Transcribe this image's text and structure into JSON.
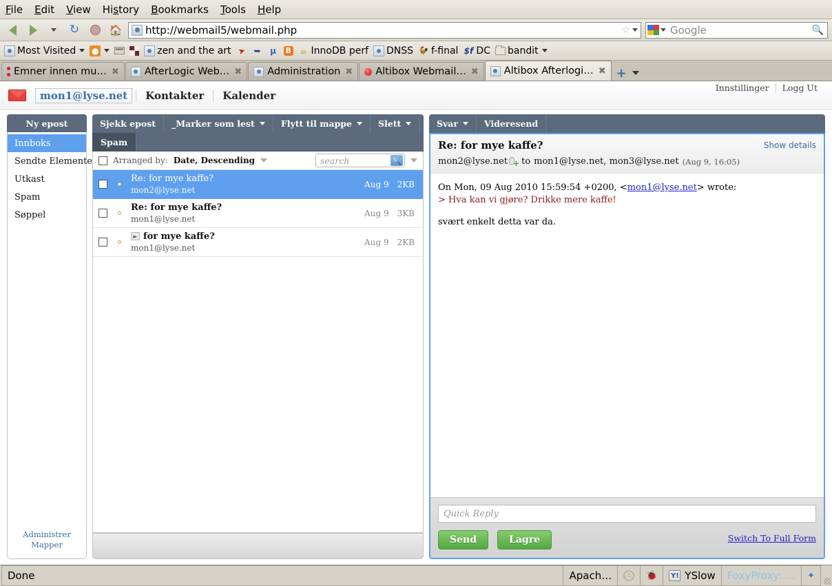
{
  "browser": {
    "menus": [
      "File",
      "Edit",
      "View",
      "History",
      "Bookmarks",
      "Tools",
      "Help"
    ],
    "url": "http://webmail5/webmail.php",
    "search_placeholder": "Google",
    "bookmarks": [
      {
        "label": "Most Visited",
        "icon": "site-icon",
        "caret": true
      },
      {
        "label": "",
        "icon": "rss-icon",
        "caret": true
      },
      {
        "label": "",
        "icon": "toolbar-icon",
        "caret": false
      },
      {
        "label": "",
        "icon": "squares-icon",
        "caret": false
      },
      {
        "label": "zen and the art",
        "icon": "site-icon",
        "caret": false
      },
      {
        "label": "",
        "icon": "red-arrow-icon",
        "caret": false
      },
      {
        "label": "",
        "icon": "blue-glyph-icon",
        "caret": false
      },
      {
        "label": "",
        "icon": "mu-icon",
        "caret": false
      },
      {
        "label": "",
        "icon": "blogger-icon",
        "caret": false
      },
      {
        "label": "InnoDB perf",
        "icon": "java-icon",
        "caret": false
      },
      {
        "label": "DNSS",
        "icon": "site-icon",
        "caret": false
      },
      {
        "label": "f-final",
        "icon": "duck-icon",
        "caret": false
      },
      {
        "label": "DC",
        "icon": "dc-icon",
        "caret": false
      },
      {
        "label": "bandit",
        "icon": "folder-icon",
        "caret": true
      }
    ],
    "tabs": [
      {
        "label": "Emner innen mu…",
        "icon": "dots-icon",
        "active": false
      },
      {
        "label": "AfterLogic Web…",
        "icon": "site-icon",
        "active": false
      },
      {
        "label": "Administration",
        "icon": "site-icon",
        "active": false
      },
      {
        "label": "Altibox Webmail…",
        "icon": "red-dot-icon",
        "active": false
      },
      {
        "label": "Altibox Afterlogi…",
        "icon": "site-icon",
        "active": true
      }
    ],
    "new_tab_label": "+"
  },
  "webmail": {
    "account": "mon1@lyse.net",
    "nav": [
      "Kontakter",
      "Kalender"
    ],
    "settings_label": "Innstillinger",
    "logout_label": "Logg Ut",
    "sidebar": {
      "compose_label": "Ny epost",
      "folders": [
        {
          "label": "Innboks",
          "selected": true
        },
        {
          "label": "Sendte Elementer",
          "selected": false
        },
        {
          "label": "Utkast",
          "selected": false
        },
        {
          "label": "Spam",
          "selected": false
        },
        {
          "label": "Søppel",
          "selected": false
        }
      ],
      "manage_folders_label": "Administrer Mapper"
    },
    "toolbar": [
      {
        "label": "Sjekk epost",
        "caret": false
      },
      {
        "label": "_Marker som lest",
        "caret": true
      },
      {
        "label": "Flytt til mappe",
        "caret": true
      },
      {
        "label": "Slett",
        "caret": true
      }
    ],
    "tabs2": [
      {
        "label": "Spam",
        "active": true
      }
    ],
    "list_header": {
      "arranged_by_label": "Arranged by:",
      "arranged_by_value": "Date, Descending",
      "search_placeholder": "search"
    },
    "messages": [
      {
        "subject": "Re: for mye kaffe?",
        "from": "mon2@lyse.net",
        "date": "Aug 9",
        "size": "2KB",
        "selected": true,
        "unread": false,
        "replied": false
      },
      {
        "subject": "Re: for mye kaffe?",
        "from": "mon1@lyse.net",
        "date": "Aug 9",
        "size": "3KB",
        "selected": false,
        "unread": true,
        "replied": false
      },
      {
        "subject": "for mye kaffe?",
        "from": "mon1@lyse.net",
        "date": "Aug 9",
        "size": "2KB",
        "selected": false,
        "unread": true,
        "replied": true
      }
    ],
    "read_toolbar": [
      {
        "label": "Svar",
        "caret": true
      },
      {
        "label": "Videresend",
        "caret": false
      }
    ],
    "message": {
      "subject": "Re: for mye kaffe?",
      "show_details_label": "Show details",
      "from": "mon2@lyse.net",
      "to_label": "to",
      "recipients": "mon1@lyse.net, mon3@lyse.net",
      "timestamp": "(Aug 9, 16:05)",
      "body_line1_pre": "On Mon, 09 Aug 2010 15:59:54 +0200, <",
      "body_line1_link": "mon1@lyse.net",
      "body_line1_post": "> wrote:",
      "body_quote": "> Hva kan vi gjøre? Drikke mere kaffe!",
      "body_line2": "svært enkelt detta var da."
    },
    "quick_reply": {
      "placeholder": "Quick Reply",
      "send_label": "Send",
      "save_label": "Lagre",
      "full_form_label": "Switch To Full Form"
    }
  },
  "status": {
    "page_status": "Done",
    "items": [
      {
        "label": "Apach…",
        "icon": ""
      },
      {
        "label": "",
        "icon": "gear-warning-icon"
      },
      {
        "label": "",
        "icon": "bug-icon"
      },
      {
        "label": "YSlow",
        "icon": "yslow-icon"
      },
      {
        "label": "FoxyProxy: …",
        "icon": ""
      },
      {
        "label": "",
        "icon": "fox-icon"
      }
    ]
  },
  "colors": {
    "accent_blue": "#5ea0ee",
    "toolbar_slate": "#5b6a7d",
    "green_button": "#52a840",
    "quote_red": "#8b1a1a",
    "link_blue": "#3a6ea5"
  }
}
